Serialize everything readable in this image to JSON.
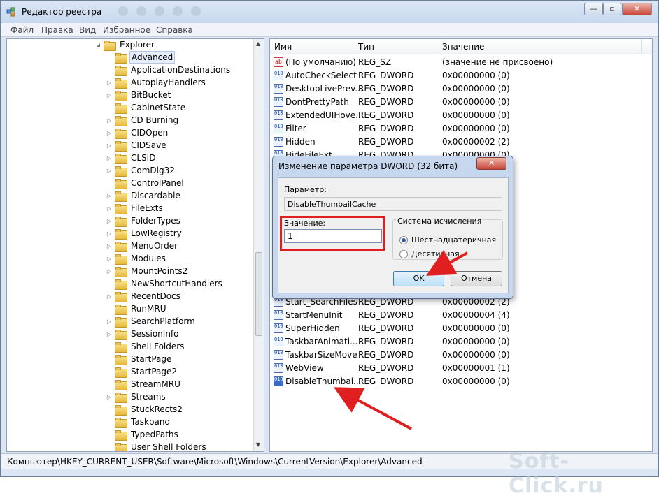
{
  "window": {
    "title": "Редактор реестра",
    "controls": {
      "min": "—",
      "max": "▫",
      "close": "✕"
    }
  },
  "menu": [
    "Файл",
    "Правка",
    "Вид",
    "Избранное",
    "Справка"
  ],
  "tree": {
    "parent": "Explorer",
    "items": [
      {
        "label": "Advanced",
        "expandable": false,
        "selected": true
      },
      {
        "label": "ApplicationDestinations",
        "expandable": false
      },
      {
        "label": "AutoplayHandlers",
        "expandable": true
      },
      {
        "label": "BitBucket",
        "expandable": true
      },
      {
        "label": "CabinetState",
        "expandable": false
      },
      {
        "label": "CD Burning",
        "expandable": true
      },
      {
        "label": "CIDOpen",
        "expandable": true
      },
      {
        "label": "CIDSave",
        "expandable": true
      },
      {
        "label": "CLSID",
        "expandable": true
      },
      {
        "label": "ComDlg32",
        "expandable": true
      },
      {
        "label": "ControlPanel",
        "expandable": false
      },
      {
        "label": "Discardable",
        "expandable": true
      },
      {
        "label": "FileExts",
        "expandable": true
      },
      {
        "label": "FolderTypes",
        "expandable": true
      },
      {
        "label": "LowRegistry",
        "expandable": true
      },
      {
        "label": "MenuOrder",
        "expandable": true
      },
      {
        "label": "Modules",
        "expandable": true
      },
      {
        "label": "MountPoints2",
        "expandable": true
      },
      {
        "label": "NewShortcutHandlers",
        "expandable": false
      },
      {
        "label": "RecentDocs",
        "expandable": true
      },
      {
        "label": "RunMRU",
        "expandable": false
      },
      {
        "label": "SearchPlatform",
        "expandable": true
      },
      {
        "label": "SessionInfo",
        "expandable": true
      },
      {
        "label": "Shell Folders",
        "expandable": false
      },
      {
        "label": "StartPage",
        "expandable": false
      },
      {
        "label": "StartPage2",
        "expandable": false
      },
      {
        "label": "StreamMRU",
        "expandable": false
      },
      {
        "label": "Streams",
        "expandable": true
      },
      {
        "label": "StuckRects2",
        "expandable": false
      },
      {
        "label": "Taskband",
        "expandable": false
      },
      {
        "label": "TypedPaths",
        "expandable": false
      },
      {
        "label": "User Shell Folders",
        "expandable": false
      }
    ]
  },
  "list": {
    "headers": {
      "name": "Имя",
      "type": "Тип",
      "value": "Значение"
    },
    "rows_top": [
      {
        "name": "(По умолчанию)",
        "type": "REG_SZ",
        "value": "(значение не присвоено)",
        "icon": "ab"
      },
      {
        "name": "AutoCheckSelect",
        "type": "REG_DWORD",
        "value": "0x00000000 (0)",
        "icon": "010"
      },
      {
        "name": "DesktopLivePrev...",
        "type": "REG_DWORD",
        "value": "0x00000000 (0)",
        "icon": "010"
      },
      {
        "name": "DontPrettyPath",
        "type": "REG_DWORD",
        "value": "0x00000000 (0)",
        "icon": "010"
      },
      {
        "name": "ExtendedUIHove...",
        "type": "REG_DWORD",
        "value": "0x00000000 (0)",
        "icon": "010"
      },
      {
        "name": "Filter",
        "type": "REG_DWORD",
        "value": "0x00000000 (0)",
        "icon": "010"
      },
      {
        "name": "Hidden",
        "type": "REG_DWORD",
        "value": "0x00000002 (2)",
        "icon": "010"
      },
      {
        "name": "HideFileExt",
        "type": "REG_DWORD",
        "value": "0x00000000 (0)",
        "icon": "010"
      }
    ],
    "rows_bottom": [
      {
        "name": "Start_SearchFiles",
        "type": "REG_DWORD",
        "value": "0x00000002 (2)",
        "icon": "010"
      },
      {
        "name": "StartMenuInit",
        "type": "REG_DWORD",
        "value": "0x00000004 (4)",
        "icon": "010"
      },
      {
        "name": "SuperHidden",
        "type": "REG_DWORD",
        "value": "0x00000000 (0)",
        "icon": "010"
      },
      {
        "name": "TaskbarAnimati...",
        "type": "REG_DWORD",
        "value": "0x00000000 (0)",
        "icon": "010"
      },
      {
        "name": "TaskbarSizeMove",
        "type": "REG_DWORD",
        "value": "0x00000000 (0)",
        "icon": "010"
      },
      {
        "name": "WebView",
        "type": "REG_DWORD",
        "value": "0x00000001 (1)",
        "icon": "010"
      },
      {
        "name": "DisableThumbai...",
        "type": "REG_DWORD",
        "value": "0x00000000 (0)",
        "icon": "010",
        "selected": true
      }
    ]
  },
  "dialog": {
    "title": "Изменение параметра DWORD (32 бита)",
    "param_label": "Параметр:",
    "param_name": "DisableThumbailCache",
    "value_label": "Значение:",
    "value": "1",
    "radix_title": "Система исчисления",
    "radix_hex": "Шестнадцатеричная",
    "radix_dec": "Десятичная",
    "radix_selected": "hex",
    "ok": "OK",
    "cancel": "Отмена",
    "close": "✕"
  },
  "status": "Компьютер\\HKEY_CURRENT_USER\\Software\\Microsoft\\Windows\\CurrentVersion\\Explorer\\Advanced",
  "watermark": "Soft-Click.ru",
  "colors": {
    "annotation": "#e02020",
    "accent": "#3c7fb1"
  }
}
